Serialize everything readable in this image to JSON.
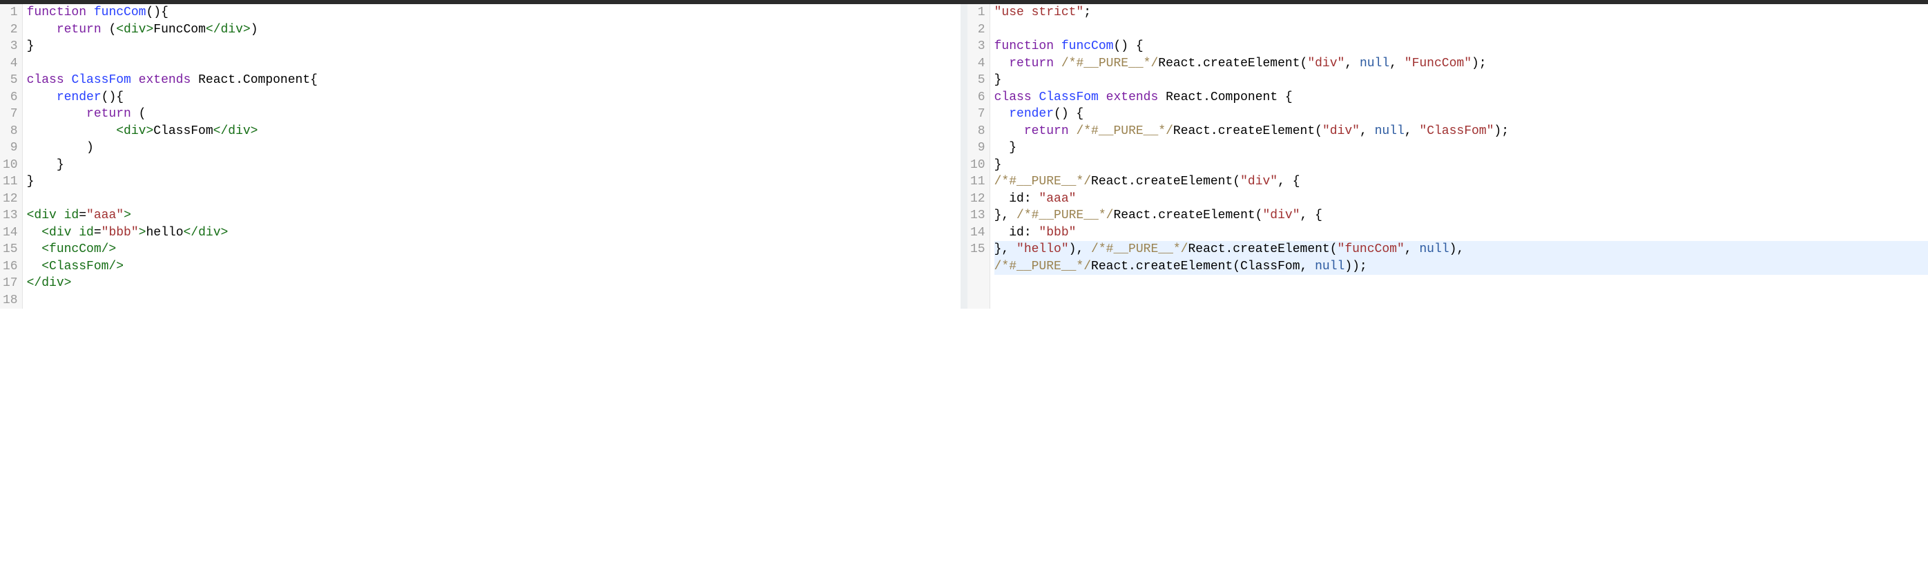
{
  "left": {
    "lines": [
      {
        "n": 1,
        "hl": false,
        "tokens": [
          [
            "kw",
            "function"
          ],
          [
            "",
            ""
          ],
          [
            "",
            ""
          ],
          [
            "",
            ""
          ],
          [
            "",
            ""
          ],
          [
            "",
            ""
          ],
          [
            "",
            ""
          ]
        ],
        "raw": [
          [
            "kw",
            "function"
          ],
          [
            "",
            " "
          ],
          [
            "fn",
            "funcCom"
          ],
          [
            "",
            "(){ "
          ]
        ]
      },
      {
        "n": 2,
        "hl": false,
        "raw": [
          [
            "",
            "    "
          ],
          [
            "kw",
            "return"
          ],
          [
            "",
            " ("
          ],
          [
            "tag",
            "<div>"
          ],
          [
            "",
            "FuncCom"
          ],
          [
            "tag",
            "</div>"
          ],
          [
            "",
            ")"
          ]
        ]
      },
      {
        "n": 3,
        "hl": false,
        "raw": [
          [
            "",
            "}"
          ]
        ]
      },
      {
        "n": 4,
        "hl": false,
        "raw": [
          [
            "",
            ""
          ]
        ]
      },
      {
        "n": 5,
        "hl": false,
        "raw": [
          [
            "kw",
            "class"
          ],
          [
            "",
            " "
          ],
          [
            "fn",
            "ClassFom"
          ],
          [
            "",
            " "
          ],
          [
            "kw",
            "extends"
          ],
          [
            "",
            " React.Component{"
          ]
        ]
      },
      {
        "n": 6,
        "hl": false,
        "raw": [
          [
            "",
            "    "
          ],
          [
            "fn",
            "render"
          ],
          [
            "",
            "(){ "
          ]
        ]
      },
      {
        "n": 7,
        "hl": false,
        "raw": [
          [
            "",
            "        "
          ],
          [
            "kw",
            "return"
          ],
          [
            "",
            " ("
          ]
        ]
      },
      {
        "n": 8,
        "hl": false,
        "raw": [
          [
            "",
            "            "
          ],
          [
            "tag",
            "<div>"
          ],
          [
            "",
            "ClassFom"
          ],
          [
            "tag",
            "</div>"
          ]
        ]
      },
      {
        "n": 9,
        "hl": false,
        "raw": [
          [
            "",
            "        )"
          ]
        ]
      },
      {
        "n": 10,
        "hl": false,
        "raw": [
          [
            "",
            "    }"
          ]
        ]
      },
      {
        "n": 11,
        "hl": false,
        "raw": [
          [
            "",
            "}"
          ]
        ]
      },
      {
        "n": 12,
        "hl": false,
        "raw": [
          [
            "",
            ""
          ]
        ]
      },
      {
        "n": 13,
        "hl": false,
        "raw": [
          [
            "tag",
            "<div "
          ],
          [
            "tag",
            "id"
          ],
          [
            "",
            "="
          ],
          [
            "str",
            "\"aaa\""
          ],
          [
            "tag",
            ">"
          ]
        ]
      },
      {
        "n": 14,
        "hl": false,
        "raw": [
          [
            "",
            "  "
          ],
          [
            "tag",
            "<div "
          ],
          [
            "tag",
            "id"
          ],
          [
            "",
            "="
          ],
          [
            "str",
            "\"bbb\""
          ],
          [
            "tag",
            ">"
          ],
          [
            "",
            "hello"
          ],
          [
            "tag",
            "</div>"
          ]
        ]
      },
      {
        "n": 15,
        "hl": false,
        "raw": [
          [
            "",
            "  "
          ],
          [
            "tag",
            "<funcCom/>"
          ]
        ]
      },
      {
        "n": 16,
        "hl": false,
        "raw": [
          [
            "",
            "  "
          ],
          [
            "tag",
            "<ClassFom/>"
          ]
        ]
      },
      {
        "n": 17,
        "hl": false,
        "raw": [
          [
            "tag",
            "</div>"
          ]
        ]
      },
      {
        "n": 18,
        "hl": false,
        "raw": [
          [
            "",
            ""
          ]
        ]
      }
    ]
  },
  "right": {
    "lines": [
      {
        "n": 1,
        "hl": false,
        "raw": [
          [
            "str",
            "\"use strict\""
          ],
          [
            "",
            ";"
          ]
        ]
      },
      {
        "n": 2,
        "hl": false,
        "raw": [
          [
            "",
            ""
          ]
        ]
      },
      {
        "n": 3,
        "hl": false,
        "raw": [
          [
            "kw",
            "function"
          ],
          [
            "",
            " "
          ],
          [
            "fn",
            "funcCom"
          ],
          [
            "",
            "() {"
          ]
        ]
      },
      {
        "n": 4,
        "hl": false,
        "raw": [
          [
            "",
            "  "
          ],
          [
            "kw",
            "return"
          ],
          [
            "",
            " "
          ],
          [
            "cmt",
            "/*#__PURE__*/"
          ],
          [
            "",
            "React.createElement("
          ],
          [
            "str",
            "\"div\""
          ],
          [
            "",
            ", "
          ],
          [
            "num",
            "null"
          ],
          [
            "",
            ", "
          ],
          [
            "str",
            "\"FuncCom\""
          ],
          [
            "",
            ");"
          ]
        ]
      },
      {
        "n": 5,
        "hl": false,
        "raw": [
          [
            "",
            "}"
          ]
        ]
      },
      {
        "n": 6,
        "hl": false,
        "raw": [
          [
            "kw",
            "class"
          ],
          [
            "",
            " "
          ],
          [
            "fn",
            "ClassFom"
          ],
          [
            "",
            " "
          ],
          [
            "kw",
            "extends"
          ],
          [
            "",
            " React.Component {"
          ]
        ]
      },
      {
        "n": 7,
        "hl": false,
        "raw": [
          [
            "",
            "  "
          ],
          [
            "fn",
            "render"
          ],
          [
            "",
            "() {"
          ]
        ]
      },
      {
        "n": 8,
        "hl": false,
        "raw": [
          [
            "",
            "    "
          ],
          [
            "kw",
            "return"
          ],
          [
            "",
            " "
          ],
          [
            "cmt",
            "/*#__PURE__*/"
          ],
          [
            "",
            "React.createElement("
          ],
          [
            "str",
            "\"div\""
          ],
          [
            "",
            ", "
          ],
          [
            "num",
            "null"
          ],
          [
            "",
            ", "
          ],
          [
            "str",
            "\"ClassFom\""
          ],
          [
            "",
            ");"
          ]
        ]
      },
      {
        "n": 9,
        "hl": false,
        "raw": [
          [
            "",
            "  }"
          ]
        ]
      },
      {
        "n": 10,
        "hl": false,
        "raw": [
          [
            "",
            "}"
          ]
        ]
      },
      {
        "n": 11,
        "hl": false,
        "raw": [
          [
            "cmt",
            "/*#__PURE__*/"
          ],
          [
            "",
            "React.createElement("
          ],
          [
            "str",
            "\"div\""
          ],
          [
            "",
            ", {"
          ]
        ]
      },
      {
        "n": 12,
        "hl": false,
        "raw": [
          [
            "",
            "  id: "
          ],
          [
            "str",
            "\"aaa\""
          ]
        ]
      },
      {
        "n": 13,
        "hl": false,
        "raw": [
          [
            "",
            "}, "
          ],
          [
            "cmt",
            "/*#__PURE__*/"
          ],
          [
            "",
            "React.createElement("
          ],
          [
            "str",
            "\"div\""
          ],
          [
            "",
            ", {"
          ]
        ]
      },
      {
        "n": 14,
        "hl": false,
        "raw": [
          [
            "",
            "  id: "
          ],
          [
            "str",
            "\"bbb\""
          ]
        ]
      },
      {
        "n": 15,
        "hl": true,
        "raw": [
          [
            "",
            "}, "
          ],
          [
            "str",
            "\"hello\""
          ],
          [
            "",
            "), "
          ],
          [
            "cmt",
            "/*#__PURE__*/"
          ],
          [
            "",
            "React.createElement("
          ],
          [
            "str",
            "\"funcCom\""
          ],
          [
            "",
            ", "
          ],
          [
            "num",
            "null"
          ],
          [
            "",
            "), "
          ]
        ]
      },
      {
        "n": null,
        "hl": true,
        "raw": [
          [
            "cmt",
            "/*#__PURE__*/"
          ],
          [
            "",
            "React.createElement(ClassFom, "
          ],
          [
            "num",
            "null"
          ],
          [
            "",
            "));"
          ]
        ]
      }
    ]
  }
}
